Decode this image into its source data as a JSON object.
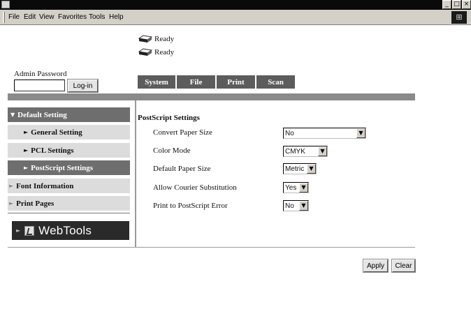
{
  "window": {
    "controls": {
      "minimize": "_",
      "maximize": "□",
      "close": "×"
    }
  },
  "menubar": {
    "items": [
      {
        "label": "File",
        "name": "menu-file"
      },
      {
        "label": "Edit",
        "name": "menu-edit"
      },
      {
        "label": "View",
        "name": "menu-view"
      },
      {
        "label": "Favorites",
        "name": "menu-favorites"
      },
      {
        "label": "Tools",
        "name": "menu-tools"
      },
      {
        "label": "Help",
        "name": "menu-help"
      }
    ]
  },
  "status": {
    "lines": [
      "Ready",
      "Ready"
    ],
    "icon": "printer-icon"
  },
  "admin": {
    "label": "Admin Password",
    "password_value": "",
    "login_label": "Log-in"
  },
  "tabs": [
    {
      "label": "System"
    },
    {
      "label": "File"
    },
    {
      "label": "Print"
    },
    {
      "label": "Scan"
    }
  ],
  "sidebar": {
    "items": [
      {
        "label": "Default Setting",
        "arrow": "▼",
        "style": "top"
      },
      {
        "label": "General Setting",
        "arrow": "►",
        "style": "sub"
      },
      {
        "label": "PCL Settings",
        "arrow": "►",
        "style": "sub"
      },
      {
        "label": "PostScript Settings",
        "arrow": "►",
        "style": "sub-active"
      },
      {
        "label": "Font Information",
        "arrow": "►",
        "style": "plain"
      },
      {
        "label": "Print Pages",
        "arrow": "►",
        "style": "plain"
      }
    ],
    "webtools": {
      "label": "WebTools",
      "arrow": "►"
    }
  },
  "settings": {
    "title": "PostScript Settings",
    "fields": [
      {
        "label": "Convert Paper Size",
        "value": "No"
      },
      {
        "label": "Color Mode",
        "value": "CMYK"
      },
      {
        "label": "Default Paper Size",
        "value": "Metric"
      },
      {
        "label": "Allow Courier Substitution",
        "value": "Yes"
      },
      {
        "label": "Print to PostScript Error",
        "value": "No"
      }
    ],
    "dropdown_glyph": "▼"
  },
  "actions": {
    "apply_label": "Apply",
    "clear_label": "Clear"
  },
  "colors": {
    "tab_bg": "#5c5c5c",
    "nav_active_bg": "#6e6e6e",
    "nav_bg": "#dcdcdc",
    "rule": "#8a8a8a",
    "webtools_bg": "#2a2a2a"
  }
}
